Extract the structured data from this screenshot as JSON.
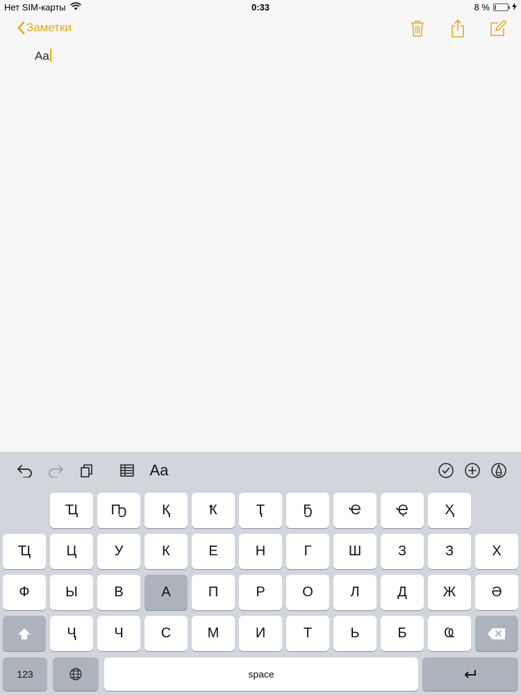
{
  "status_bar": {
    "carrier": "Нет SIM-карты",
    "time": "0:33",
    "battery_percent": "8 %",
    "battery_level": 0.08
  },
  "nav": {
    "back_label": "Заметки"
  },
  "note": {
    "text": "Aa"
  },
  "toolbar": {
    "format_label": "Aa"
  },
  "keyboard": {
    "row1": [
      "Ҵ",
      "Ҧ",
      "Қ",
      "Ҟ",
      "Ҭ",
      "Ҕ",
      "Ҽ",
      "Ҿ",
      "Ҳ"
    ],
    "row2": [
      "Ҵ",
      "Ц",
      "У",
      "К",
      "Е",
      "Н",
      "Г",
      "Ш",
      "З",
      "З",
      "Х"
    ],
    "row3": [
      "Ф",
      "Ы",
      "В",
      "А",
      "П",
      "Р",
      "О",
      "Л",
      "Д",
      "Ж",
      "Ә"
    ],
    "row4": [
      "Ҷ",
      "Ч",
      "С",
      "М",
      "И",
      "Т",
      "Ь",
      "Б",
      "Ҩ"
    ],
    "numbers_label": "123",
    "space_label": "space",
    "pressed_key": "А"
  },
  "colors": {
    "accent": "#e3a91f",
    "keyboard_bg": "#d2d5db",
    "key_bg": "#ffffff",
    "key_dark_bg": "#adb3bc"
  }
}
